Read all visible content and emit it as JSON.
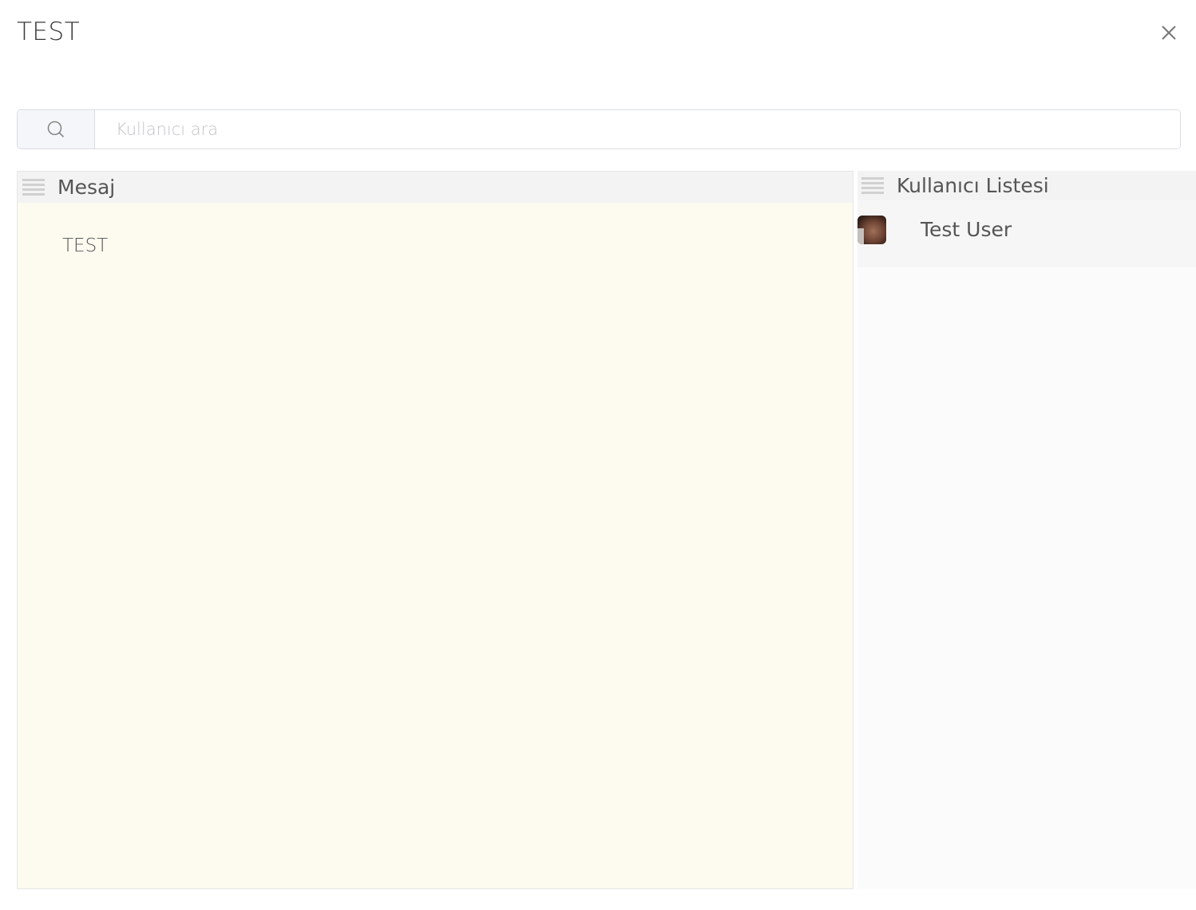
{
  "modal": {
    "title": "TEST",
    "close_icon": "close-icon"
  },
  "search": {
    "icon": "search-icon",
    "placeholder": "Kullanıcı ara",
    "value": ""
  },
  "message_panel": {
    "title": "Mesaj",
    "handle_icon": "drag-handle-icon",
    "content": "TEST",
    "background": "#fdfbf0"
  },
  "users_panel": {
    "title": "Kullanıcı Listesi",
    "handle_icon": "drag-handle-icon",
    "users": [
      {
        "name": "Test User"
      }
    ]
  }
}
